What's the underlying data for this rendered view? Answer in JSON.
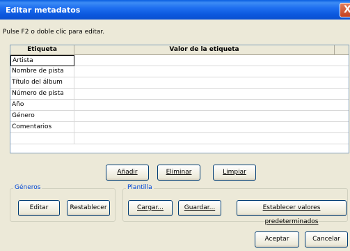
{
  "window": {
    "title": "Editar metadatos",
    "close_glyph": "X"
  },
  "hint": "Pulse F2 o doble clic para editar.",
  "table": {
    "columns": [
      "Etiqueta",
      "Valor de la etiqueta"
    ],
    "rows": [
      {
        "label": "Artista",
        "value": ""
      },
      {
        "label": "Nombre de pista",
        "value": ""
      },
      {
        "label": "Título del álbum",
        "value": ""
      },
      {
        "label": "Número de pista",
        "value": ""
      },
      {
        "label": "Año",
        "value": ""
      },
      {
        "label": "Género",
        "value": ""
      },
      {
        "label": "Comentarios",
        "value": ""
      },
      {
        "label": "",
        "value": ""
      }
    ]
  },
  "row_buttons": {
    "add": "Añadir",
    "delete": "Eliminar",
    "clear": "Limpiar"
  },
  "genres": {
    "legend": "Géneros",
    "edit": "Editar",
    "reset": "Restablecer"
  },
  "template": {
    "legend": "Plantilla",
    "load": "Cargar...",
    "save": "Guardar...",
    "defaults": "Establecer valores predeterminados"
  },
  "footer": {
    "ok": "Aceptar",
    "cancel": "Cancelar"
  }
}
